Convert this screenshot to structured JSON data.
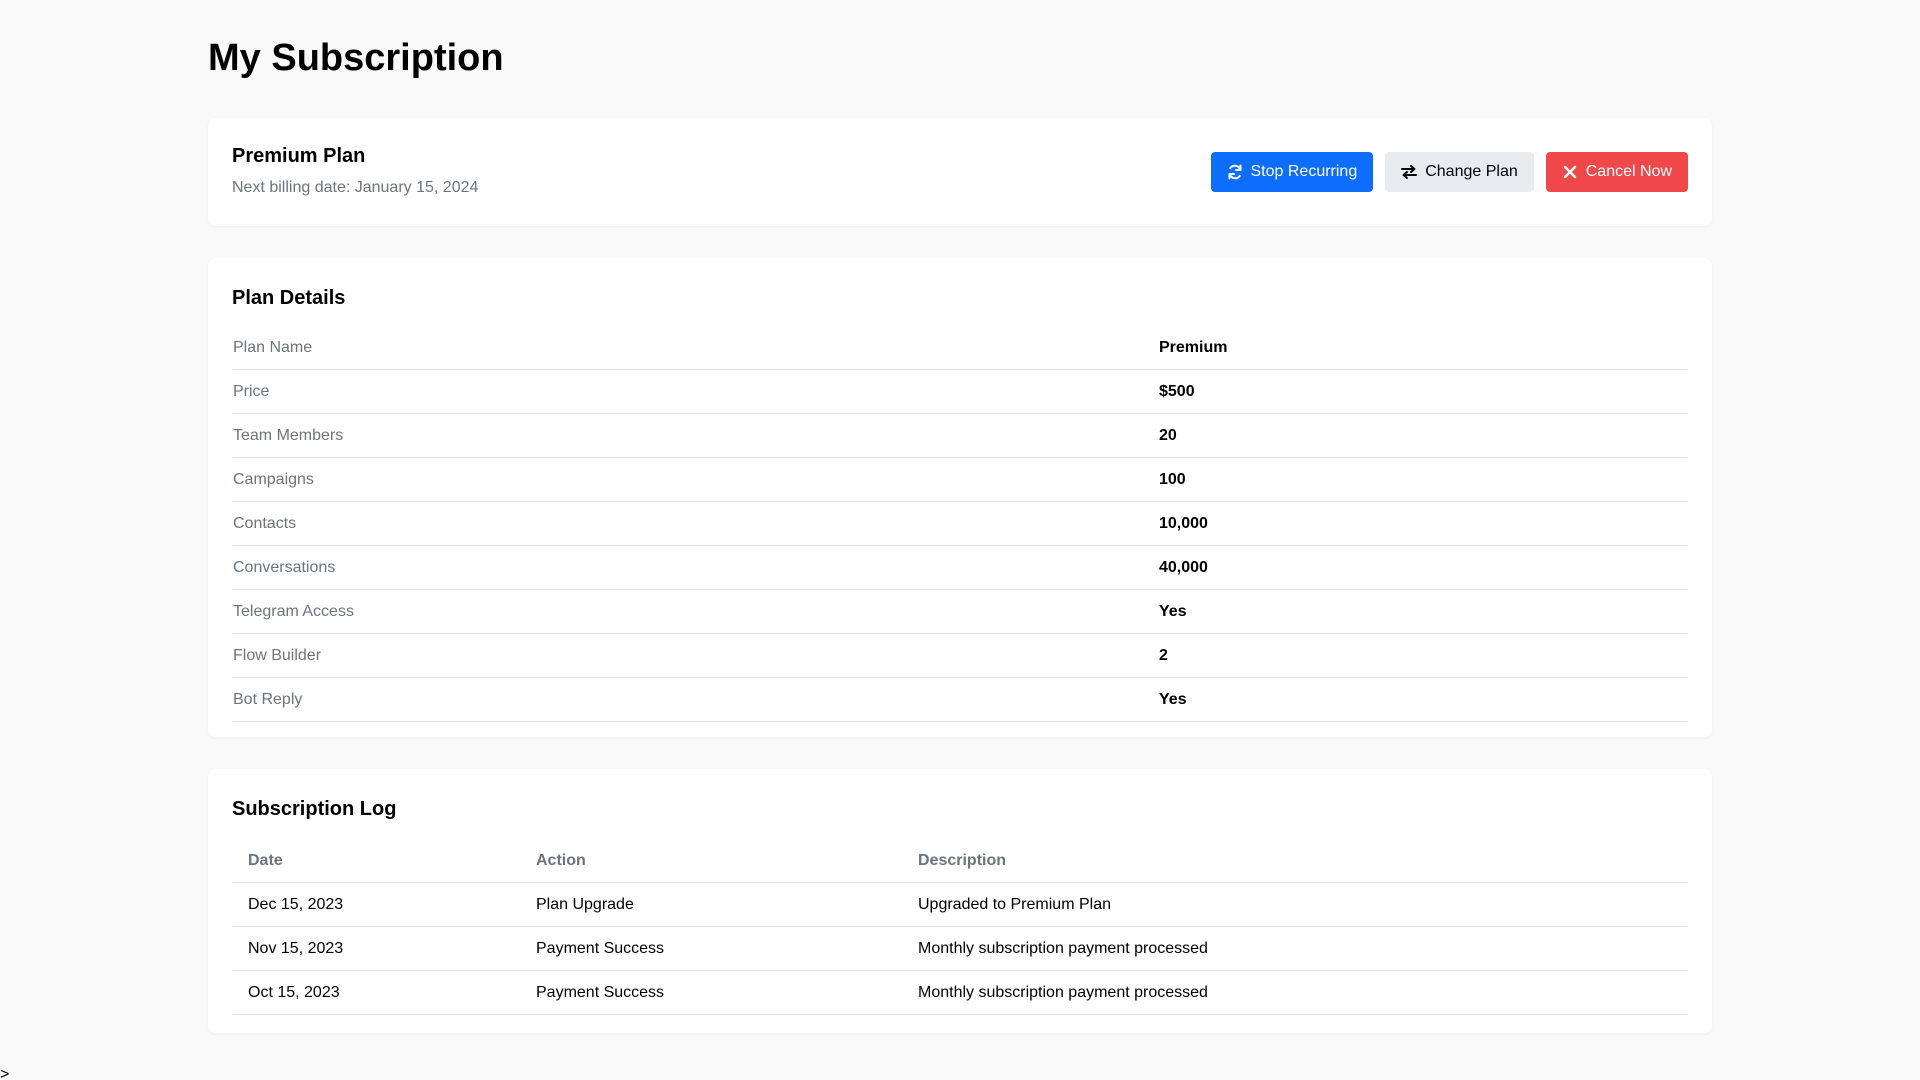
{
  "page": {
    "title": "My Subscription",
    "stray_text": ">"
  },
  "plan_summary": {
    "name": "Premium Plan",
    "billing": "Next billing date: January 15, 2024",
    "buttons": {
      "stop_recurring": "Stop Recurring",
      "change_plan": "Change Plan",
      "cancel_now": "Cancel Now"
    },
    "colors": {
      "primary": "#0d6efd",
      "secondary": "#e9ecef",
      "danger": "#f04848"
    }
  },
  "plan_details": {
    "heading": "Plan Details",
    "rows": [
      {
        "label": "Plan Name",
        "value": "Premium"
      },
      {
        "label": "Price",
        "value": "$500"
      },
      {
        "label": "Team Members",
        "value": "20"
      },
      {
        "label": "Campaigns",
        "value": "100"
      },
      {
        "label": "Contacts",
        "value": "10,000"
      },
      {
        "label": "Conversations",
        "value": "40,000"
      },
      {
        "label": "Telegram Access",
        "value": "Yes"
      },
      {
        "label": "Flow Builder",
        "value": "2"
      },
      {
        "label": "Bot Reply",
        "value": "Yes"
      }
    ]
  },
  "subscription_log": {
    "heading": "Subscription Log",
    "columns": [
      "Date",
      "Action",
      "Description"
    ],
    "rows": [
      {
        "date": "Dec 15, 2023",
        "action": "Plan Upgrade",
        "description": "Upgraded to Premium Plan"
      },
      {
        "date": "Nov 15, 2023",
        "action": "Payment Success",
        "description": "Monthly subscription payment processed"
      },
      {
        "date": "Oct 15, 2023",
        "action": "Payment Success",
        "description": "Monthly subscription payment processed"
      }
    ]
  },
  "icons": {
    "stop_recurring": "sync-icon",
    "change_plan": "exchange-icon",
    "cancel_now": "close-icon"
  }
}
